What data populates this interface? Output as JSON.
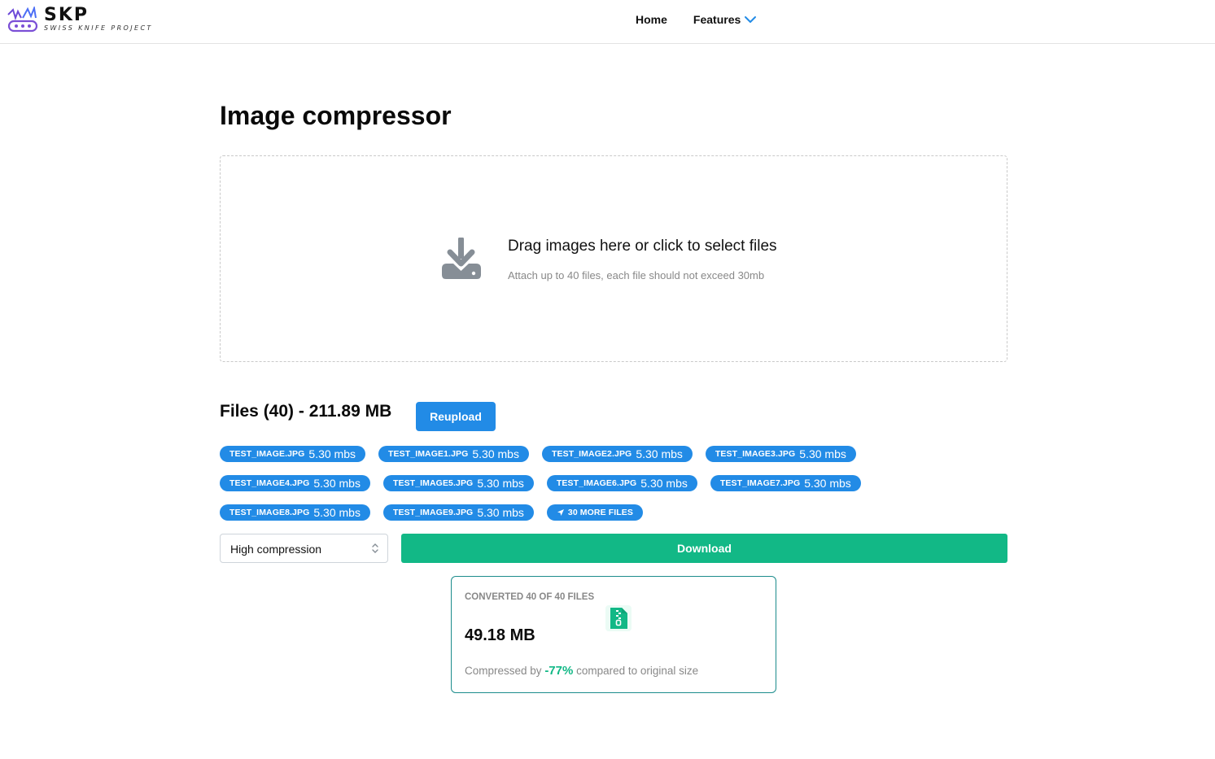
{
  "header": {
    "logo_text": "SKP",
    "logo_subtitle": "SWISS KNIFE PROJECT",
    "nav": {
      "home": "Home",
      "features": "Features"
    }
  },
  "page": {
    "title": "Image compressor"
  },
  "dropzone": {
    "title": "Drag images here or click to select files",
    "subtitle": "Attach up to 40 files, each file should not exceed 30mb"
  },
  "files": {
    "heading": "Files (40) - 211.89 MB",
    "reupload_label": "Reupload",
    "badges": [
      {
        "name": "test_image.jpg",
        "size": "5.30 mbs"
      },
      {
        "name": "test_image1.jpg",
        "size": "5.30 mbs"
      },
      {
        "name": "test_image2.jpg",
        "size": "5.30 mbs"
      },
      {
        "name": "test_image3.jpg",
        "size": "5.30 mbs"
      },
      {
        "name": "test_image4.jpg",
        "size": "5.30 mbs"
      },
      {
        "name": "test_image5.jpg",
        "size": "5.30 mbs"
      },
      {
        "name": "test_image6.jpg",
        "size": "5.30 mbs"
      },
      {
        "name": "test_image7.jpg",
        "size": "5.30 mbs"
      },
      {
        "name": "test_image8.jpg",
        "size": "5.30 mbs"
      },
      {
        "name": "test_image9.jpg",
        "size": "5.30 mbs"
      }
    ],
    "more_label": "30 more files"
  },
  "controls": {
    "compression_selected": "High compression",
    "download_label": "Download"
  },
  "result": {
    "converted_label": "Converted 40 of 40 files",
    "size": "49.18 MB",
    "foot_prefix": "Compressed by",
    "percent": "-77%",
    "foot_suffix": "compared to original size"
  },
  "colors": {
    "accent_blue": "#228be6",
    "accent_green": "#12b886",
    "card_border": "#1c8c8c"
  },
  "icons": {
    "logo": "swiss-knife-logo",
    "features_dropdown": "chevron-down-icon",
    "dropzone": "download-tray-icon",
    "more_files": "arrow-up-right-icon",
    "select": "up-down-caret-icon",
    "result": "zip-file-icon"
  }
}
